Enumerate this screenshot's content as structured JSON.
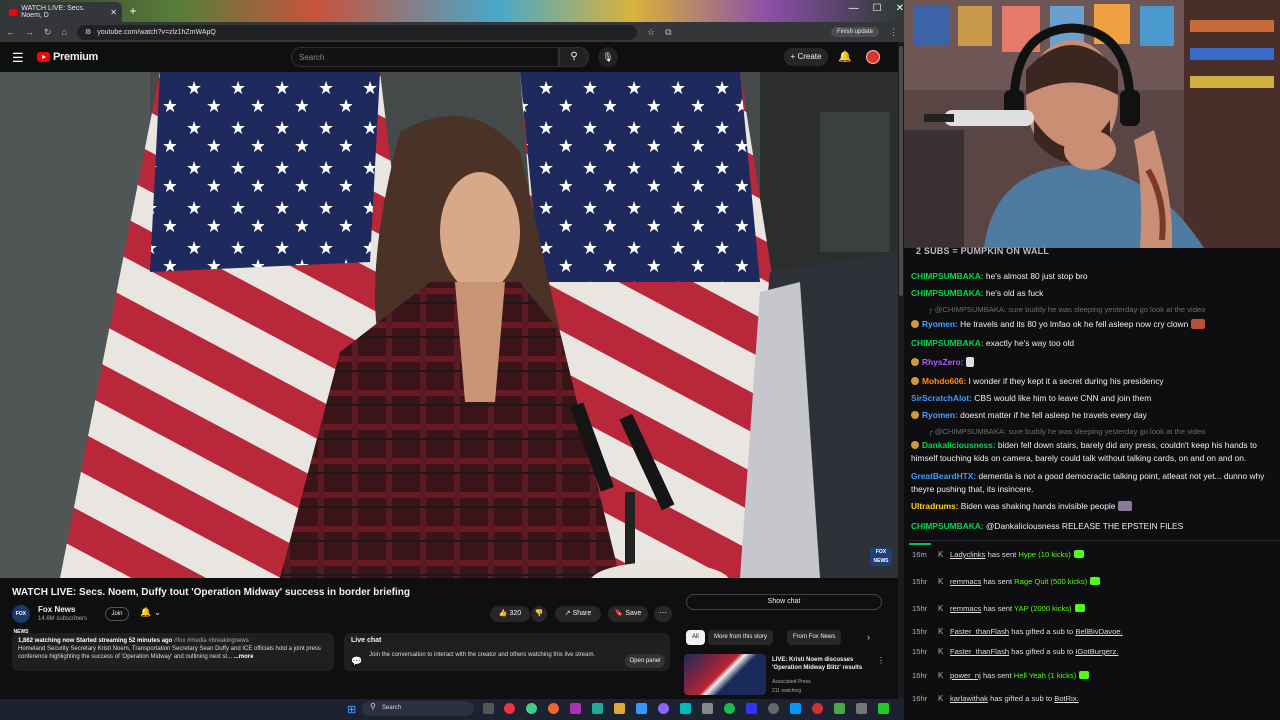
{
  "browser": {
    "tab_title": "WATCH LIVE: Secs. Noem, D",
    "url": "youtube.com/watch?v=zlz1hZmWApQ",
    "finish_update": "Finish update"
  },
  "youtube": {
    "brand": "Premium",
    "search_placeholder": "Search",
    "create_label": "Create"
  },
  "video": {
    "title": "WATCH LIVE: Secs. Noem, Duffy tout 'Operation Midway' success in border briefing",
    "channel_name": "Fox News",
    "channel_subs": "14.6M subscribers",
    "channel_logo_text": "FOX NEWS",
    "join_label": "Join",
    "like_count": "320",
    "share_label": "Share",
    "save_label": "Save",
    "watermark": "FOX NEWS",
    "description": {
      "stats": "1,862 watching now  Started streaming 52 minutes ago",
      "tags": "#fox #media #breakingnews",
      "text": "Homeland Security Secretary Kristi Noem, Transportation Secretary Sean Duffy and ICE officials hold a joint press conference highlighting the success of 'Operation Midway' and outlining next st...",
      "more": "...more"
    }
  },
  "live_chat": {
    "title": "Live chat",
    "text": "Join the conversation to interact with the creator and others watching this live stream.",
    "open_panel": "Open panel",
    "show_chat": "Show chat"
  },
  "recommendations": {
    "chips": [
      "All",
      "More from this story",
      "From Fox News"
    ],
    "item": {
      "title": "LIVE: Kristi Noem discusses 'Operation Midway Blitz' results",
      "channel": "Associated Press",
      "watching": "211 watching"
    }
  },
  "taskbar": {
    "search_label": "Search"
  },
  "stream_chat": {
    "goal_banner": "2 SUBS = PUMPKIN ON WALL",
    "messages": [
      {
        "user": "CHIMPSUMBAKA:",
        "text": " he's almost 80 just stop bro",
        "color": "#00d84e"
      },
      {
        "user": "CHIMPSUMBAKA:",
        "text": " he's old as fuck",
        "color": "#00d84e"
      },
      {
        "reply": "@CHIMPSUMBAKA: sure buddy he was sleeping yesterday go look at the video"
      },
      {
        "user": "Ryomen:",
        "text": " He travels and its 80 yo lmfao ok he fell asleep now cry clown",
        "color": "#4fa0ff"
      },
      {
        "user": "CHIMPSUMBAKA:",
        "text": " exactly he's way too old",
        "color": "#00d84e"
      },
      {
        "user": "RhysZero:",
        "text": "",
        "color": "#b05cff"
      },
      {
        "user": "Mohdo606:",
        "text": " I wonder if they kept it a secret during his presidency",
        "color": "#ff8c1a"
      },
      {
        "user": "SirScratchAlot:",
        "text": " CBS would like him to leave CNN and join them",
        "color": "#3e9cff"
      },
      {
        "user": "Ryomen:",
        "text": " doesnt matter if he fell asleep he travels every day",
        "color": "#4fa0ff"
      },
      {
        "reply": "@CHIMPSUMBAKA: sure buddy he was sleeping yesterday go look at the video"
      },
      {
        "user": "Dankaliciousness:",
        "text": " biden fell down stairs, barely did any press, couldn't keep his hands to himself touching kids on camera, barely could talk without talking cards, on and on and on.",
        "color": "#00d84e"
      },
      {
        "user": "GreatBeardHTX:",
        "text": " dementia is not a good democractic talking point, atleast not yet... dunno why theyre pushing that, its insincere.",
        "color": "#3e9cff"
      },
      {
        "user": "Ultradrums:",
        "text": " Biden was shaking hands invisible people",
        "color": "#ffd21a"
      },
      {
        "user": "CHIMPSUMBAKA:",
        "text": " @Dankaliciousness RELEASE THE EPSTEIN FILES",
        "color": "#00d84e"
      }
    ],
    "events": [
      {
        "time": "16m",
        "name": "Ladyclinks",
        "mid": " has sent ",
        "gift": "Hype (10 kicks)"
      },
      {
        "time": "15hr",
        "name": "remmacs",
        "mid": " has sent ",
        "gift": "Rage Quit (500 kicks)"
      },
      {
        "time": "15hr",
        "name": "remmacs",
        "mid": " has sent ",
        "gift": "YAP (2000 kicks)"
      },
      {
        "time": "15hr",
        "name": "Faster_thanFlash",
        "mid": " has gifted a sub to ",
        "target": "BellBivDavoe."
      },
      {
        "time": "15hr",
        "name": "Faster_thanFlash",
        "mid": " has gifted a sub to ",
        "target": "IGotBurgerz."
      },
      {
        "time": "16hr",
        "name": "power_nj",
        "mid": " has sent ",
        "gift": "Hell Yeah (1 kicks)"
      },
      {
        "time": "16hr",
        "name": "karlawithak",
        "mid": " has gifted a sub to ",
        "target": "BotRix."
      }
    ]
  }
}
